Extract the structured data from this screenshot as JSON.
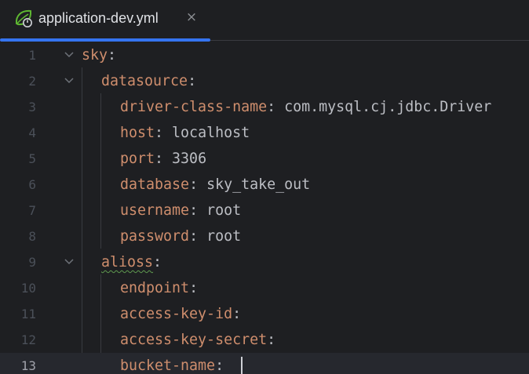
{
  "tab": {
    "title": "application-dev.yml",
    "icon": "spring-leaf-icon",
    "close_glyph": "×",
    "active_underline_color": "#3574f0"
  },
  "editor": {
    "current_line": 13,
    "lines": [
      {
        "num": "1",
        "key": "sky",
        "value": "",
        "fold": true
      },
      {
        "num": "2",
        "key": "datasource",
        "value": "",
        "fold": true
      },
      {
        "num": "3",
        "key": "driver-class-name",
        "value": "com.mysql.cj.jdbc.Driver",
        "fold": false
      },
      {
        "num": "4",
        "key": "host",
        "value": "localhost",
        "fold": false
      },
      {
        "num": "5",
        "key": "port",
        "value": "3306",
        "fold": false
      },
      {
        "num": "6",
        "key": "database",
        "value": "sky_take_out",
        "fold": false
      },
      {
        "num": "7",
        "key": "username",
        "value": "root",
        "fold": false
      },
      {
        "num": "8",
        "key": "password",
        "value": "root",
        "fold": false
      },
      {
        "num": "9",
        "key": "alioss",
        "value": "",
        "fold": true
      },
      {
        "num": "10",
        "key": "endpoint",
        "value": "",
        "fold": false
      },
      {
        "num": "11",
        "key": "access-key-id",
        "value": "",
        "fold": false
      },
      {
        "num": "12",
        "key": "access-key-secret",
        "value": "",
        "fold": false
      },
      {
        "num": "13",
        "key": "bucket-name",
        "value": "",
        "fold": false
      }
    ]
  },
  "colors": {
    "background": "#1e1f22",
    "key": "#cf8e6d",
    "text": "#bcbec4",
    "line_number": "#4b5059",
    "current_line_bg": "#26282e"
  }
}
